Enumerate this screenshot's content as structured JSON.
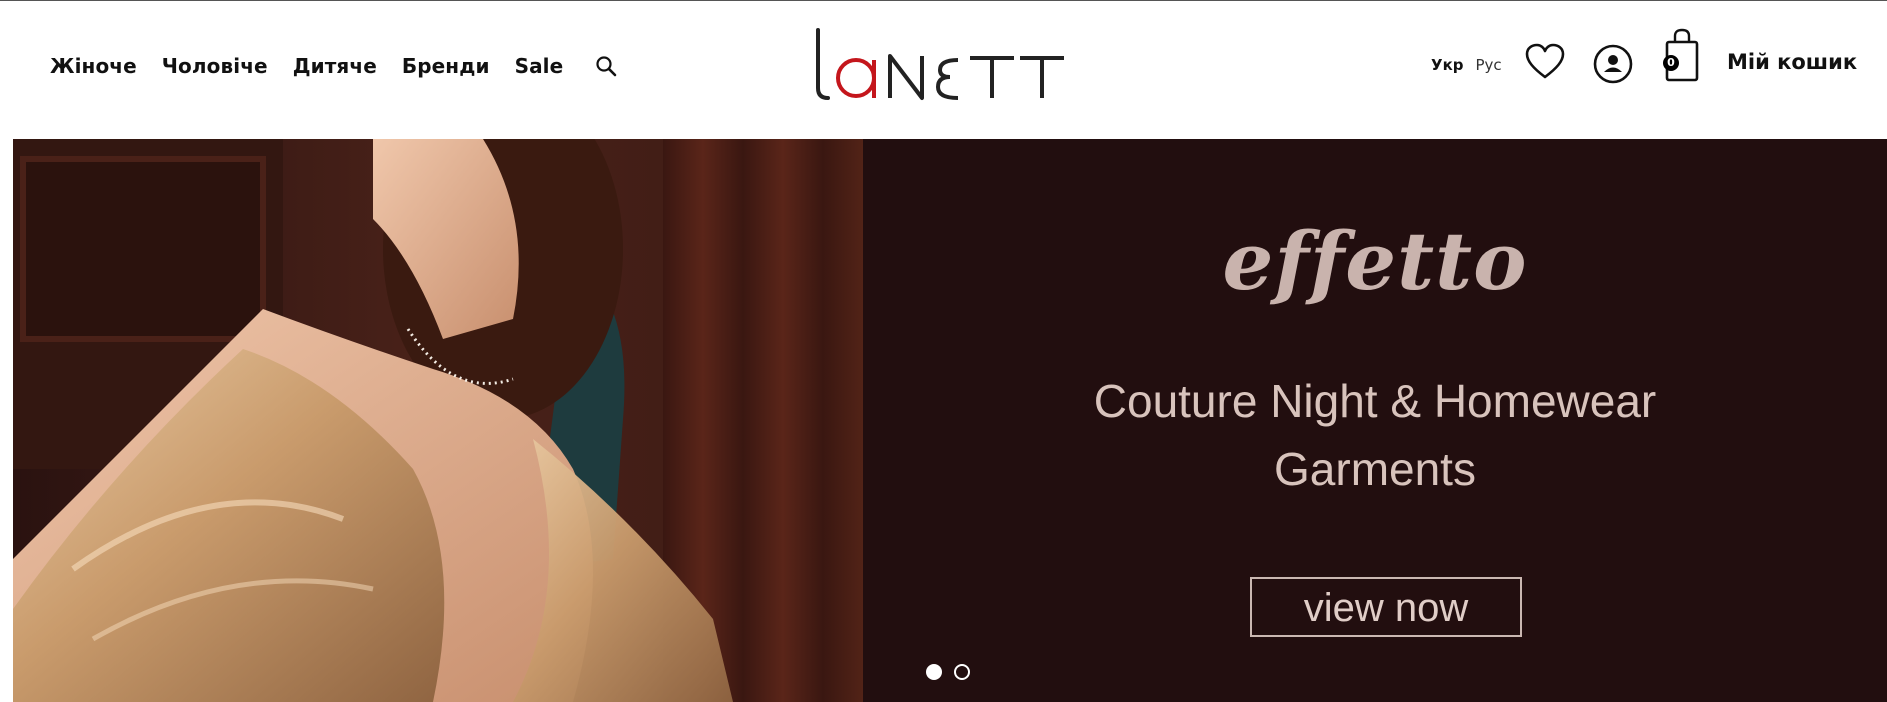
{
  "nav": {
    "items": [
      {
        "label": "Жіноче"
      },
      {
        "label": "Чоловіче"
      },
      {
        "label": "Дитяче"
      },
      {
        "label": "Бренди"
      },
      {
        "label": "Sale"
      }
    ],
    "search_icon": "search-icon"
  },
  "logo": {
    "text": "lanett",
    "accent_color": "#c4161c"
  },
  "lang": {
    "active": "Укр",
    "inactive": "Рус"
  },
  "icons": {
    "wishlist": "heart-icon",
    "account": "user-icon",
    "cart": "shopping-bag-icon"
  },
  "cart": {
    "count": "0",
    "label": "Мій кошик"
  },
  "hero": {
    "brand": "effetto",
    "tagline_line1": "Couture Night & Homewear",
    "tagline_line2": "Garments",
    "cta": "view now",
    "slide_count": 2,
    "active_slide": 1,
    "panel_color": "#220e0f"
  }
}
